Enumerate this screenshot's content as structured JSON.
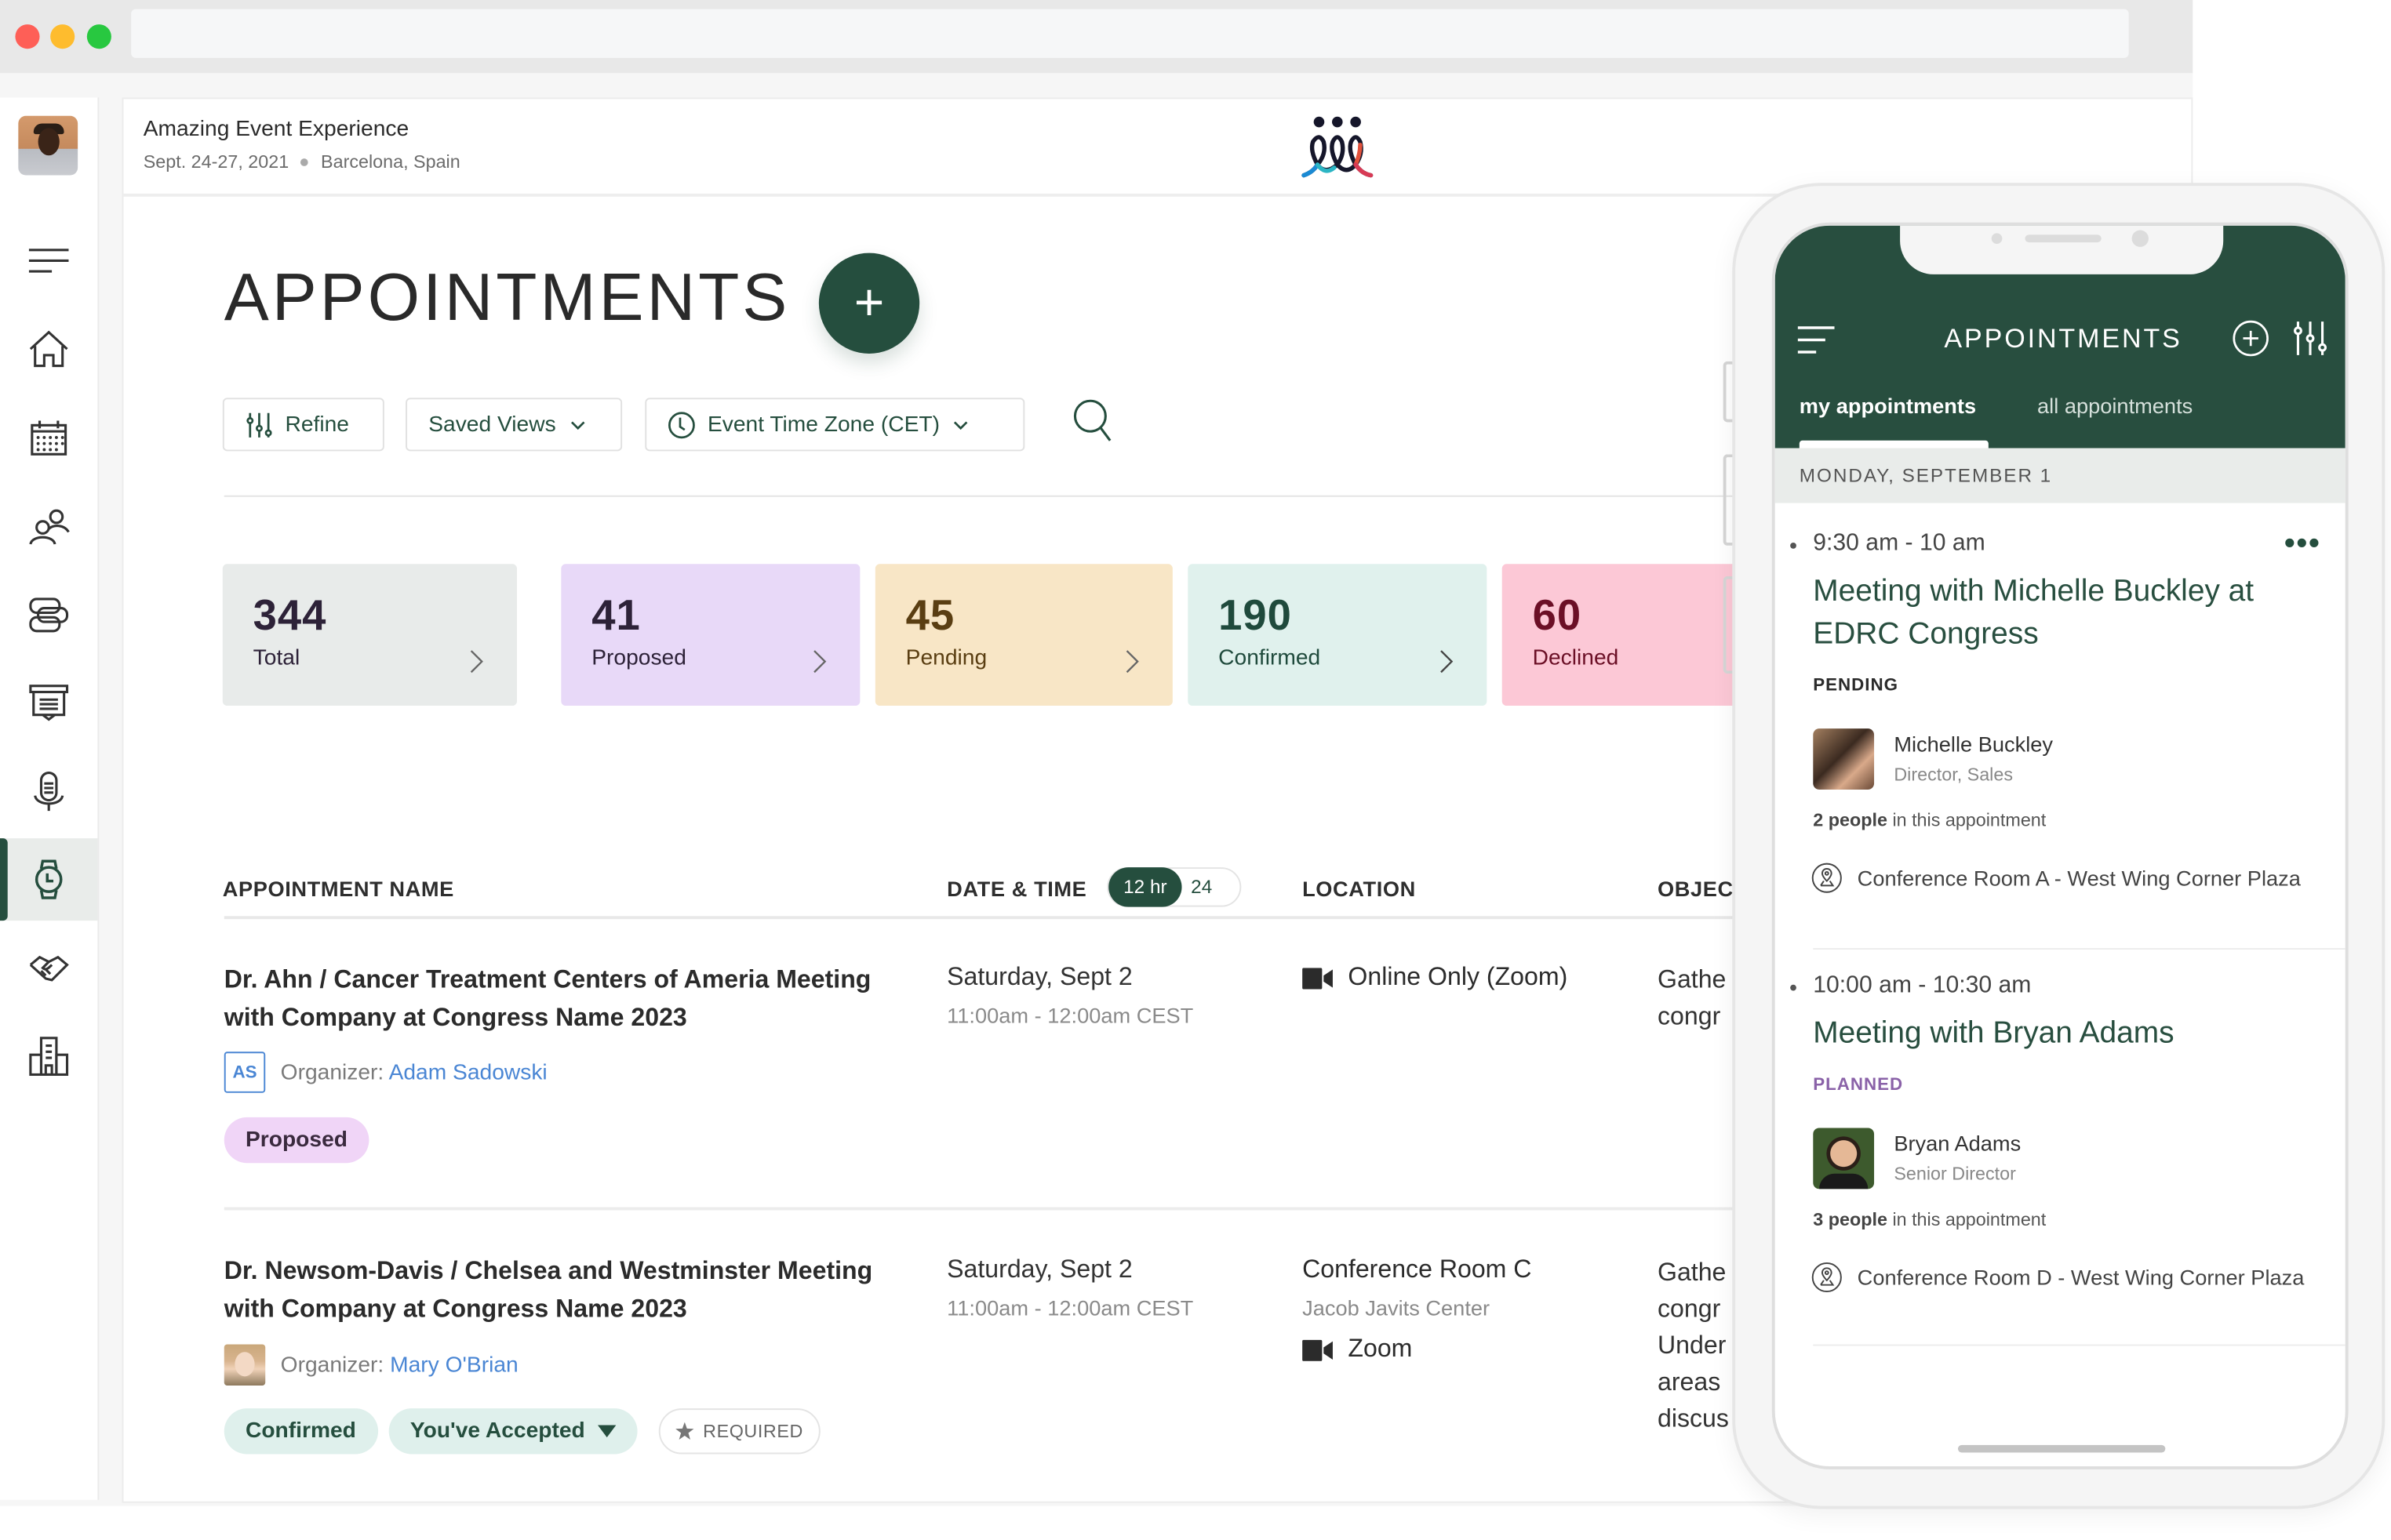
{
  "event": {
    "title": "Amazing Event Experience",
    "dates": "Sept. 24-27, 2021",
    "location": "Barcelona, Spain"
  },
  "sidebar": {
    "items": [
      {
        "name": "menu",
        "icon": "hamburger-icon"
      },
      {
        "name": "home",
        "icon": "home-icon"
      },
      {
        "name": "calendar",
        "icon": "calendar-icon"
      },
      {
        "name": "people",
        "icon": "people-icon"
      },
      {
        "name": "sessions",
        "icon": "sessions-icon"
      },
      {
        "name": "presentations",
        "icon": "presentation-icon"
      },
      {
        "name": "speakers",
        "icon": "microphone-icon"
      },
      {
        "name": "appointments",
        "icon": "watch-icon",
        "active": true
      },
      {
        "name": "sponsors",
        "icon": "handshake-icon"
      },
      {
        "name": "exhibitors",
        "icon": "building-icon"
      }
    ]
  },
  "page": {
    "title": "APPOINTMENTS",
    "add_label": "+"
  },
  "filters": {
    "refine": "Refine",
    "saved_views": "Saved Views",
    "timezone": "Event Time Zone (CET)"
  },
  "stats": [
    {
      "value": "344",
      "label": "Total",
      "bg": "#e8ebea",
      "color": "#2d2238"
    },
    {
      "value": "41",
      "label": "Proposed",
      "bg": "#e8d9f8",
      "color": "#2d2238"
    },
    {
      "value": "45",
      "label": "Pending",
      "bg": "#f8e6c6",
      "color": "#5a3e12"
    },
    {
      "value": "190",
      "label": "Confirmed",
      "bg": "#e0f1ed",
      "color": "#1f4a3c"
    },
    {
      "value": "60",
      "label": "Declined",
      "bg": "#fcc8d6",
      "color": "#6b0f26"
    }
  ],
  "table": {
    "columns": {
      "name": "APPOINTMENT NAME",
      "datetime": "DATE & TIME",
      "location": "LOCATION",
      "objective": "OBJEC"
    },
    "time_format": {
      "on": "12 hr",
      "off": "24"
    },
    "rows": [
      {
        "name_line1": "Dr. Ahn / Cancer Treatment Centers of Ameria Meeting",
        "name_line2": "with Company at Congress Name 2023",
        "organizer_label": "Organizer:",
        "organizer": "Adam Sadowski",
        "organizer_initials": "AS",
        "date": "Saturday, Sept 2",
        "time": "11:00am - 12:00am CEST",
        "location": "Online Only (Zoom)",
        "objective": [
          "Gathe",
          "congr"
        ],
        "status": "Proposed"
      },
      {
        "name_line1": "Dr. Newsom-Davis / Chelsea and Westminster Meeting",
        "name_line2": "with Company at Congress Name 2023",
        "organizer_label": "Organizer:",
        "organizer": "Mary O'Brian",
        "date": "Saturday, Sept 2",
        "time": "11:00am - 12:00am CEST",
        "location": "Conference Room C",
        "location_sub": "Jacob Javits Center",
        "location_virtual": "Zoom",
        "objective": [
          "Gathe",
          "congr",
          "Under",
          "areas",
          "discus"
        ],
        "status": "Confirmed",
        "response": "You've Accepted",
        "required": "REQUIRED"
      }
    ]
  },
  "phone": {
    "title": "APPOINTMENTS",
    "tabs": [
      "my appointments",
      "all appointments"
    ],
    "date_header": "MONDAY, SEPTEMBER 1",
    "items": [
      {
        "time": "9:30 am - 10 am",
        "title": "Meeting with Michelle Buckley at EDRC Congress",
        "status": "PENDING",
        "status_color": "#2b2b2b",
        "person": "Michelle Buckley",
        "role": "Director, Sales",
        "people_count": "2 people",
        "people_suffix": "in this appointment",
        "location": "Conference Room A - West Wing Corner Plaza",
        "more": "•••"
      },
      {
        "time": "10:00 am - 10:30 am",
        "title": "Meeting with Bryan Adams",
        "status": "PLANNED",
        "status_color": "#8a62a8",
        "person": "Bryan Adams",
        "role": "Senior Director",
        "people_count": "3 people",
        "people_suffix": "in this appointment",
        "location": "Conference Room D - West Wing Corner Plaza"
      }
    ]
  },
  "colors": {
    "brand": "#254e3e",
    "link": "#4a86d4"
  }
}
